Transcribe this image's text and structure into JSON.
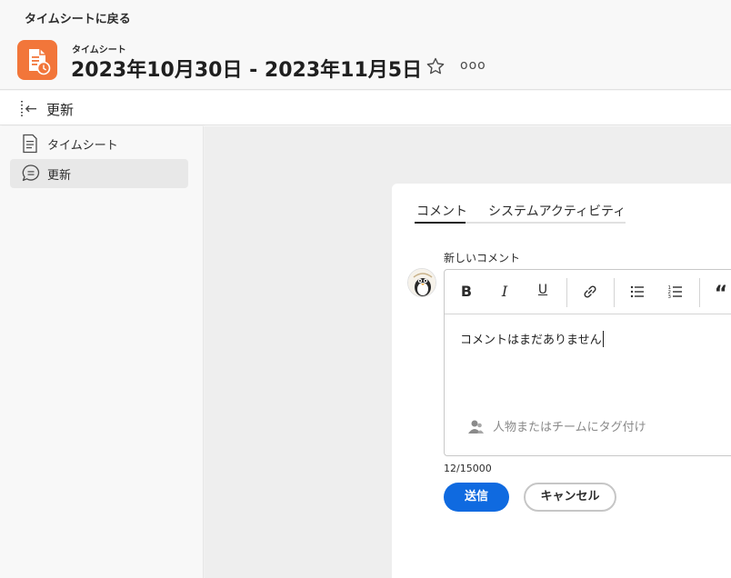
{
  "header": {
    "back_link": "タイムシートに戻る",
    "subtitle": "タイムシート",
    "title": "2023年10月30日 - 2023年11月5日",
    "more": "ooo"
  },
  "toolbar": {
    "title": "更新"
  },
  "sidebar": {
    "items": [
      {
        "label": "タイムシート",
        "icon": "document-icon",
        "active": false
      },
      {
        "label": "更新",
        "icon": "chat-bubble-icon",
        "active": true
      }
    ]
  },
  "main": {
    "tabs": [
      {
        "label": "コメント",
        "active": true
      },
      {
        "label": "システムアクティビティ",
        "active": false
      }
    ],
    "new_comment_label": "新しいコメント",
    "editor": {
      "buttons": [
        {
          "name": "bold",
          "glyph": "B"
        },
        {
          "name": "italic",
          "glyph": "I"
        },
        {
          "name": "underline",
          "glyph": "U"
        },
        {
          "name": "link",
          "glyph": "link-icon"
        },
        {
          "name": "bulleted-list",
          "glyph": "bullet-list-icon"
        },
        {
          "name": "numbered-list",
          "glyph": "numbered-list-icon"
        },
        {
          "name": "quote",
          "glyph": "“"
        }
      ],
      "text": "コメントはまだありません",
      "tag_placeholder": "人物またはチームにタグ付け"
    },
    "char_count": "12/15000",
    "send_label": "送信",
    "cancel_label": "キャンセル"
  },
  "colors": {
    "accent_blue": "#0f6ae0",
    "app_icon_orange": "#f2763a"
  }
}
